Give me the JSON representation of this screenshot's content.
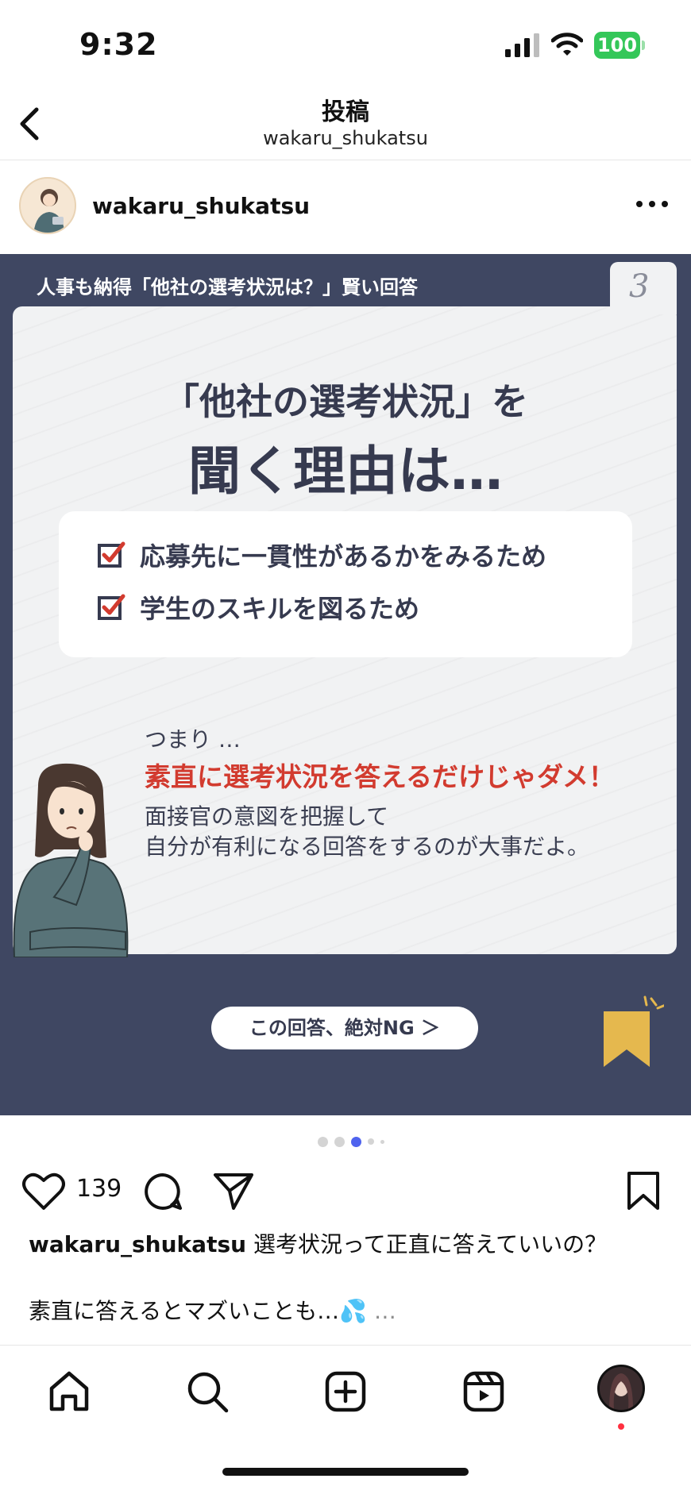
{
  "status_bar": {
    "time": "9:32",
    "battery": "100"
  },
  "header": {
    "title": "投稿",
    "subtitle": "wakaru_shukatsu"
  },
  "post": {
    "author": "wakaru_shukatsu",
    "slide": {
      "tag": "人事も納得「他社の選考状況は？」賢い回答",
      "page_number": "3",
      "headline_1": "「他社の選考状況」を",
      "headline_2": "聞く理由は…",
      "reasons": [
        "応募先に一貫性があるかをみるため",
        "学生のスキルを図るため"
      ],
      "summary_lead": "つまり …",
      "summary_emphasis": "素直に選考状況を答えるだけじゃダメ！",
      "summary_body_1": "面接官の意図を把握して",
      "summary_body_2": "自分が有利になる回答をするのが大事だよ。",
      "cta_label": "この回答、絶対NG ＞",
      "accent_red": "#d23b2f",
      "background": "#3f4762"
    },
    "carousel": {
      "total": 5,
      "active_index": 2
    },
    "likes": "139",
    "caption_user": "wakaru_shukatsu",
    "caption_text": " 選考状況って正直に答えていいの？",
    "caption_line_2": "素直に答えるとマズいことも…💦",
    "caption_more": " …"
  },
  "tab_bar": {
    "items": [
      "home-icon",
      "search-icon",
      "create-icon",
      "reels-icon",
      "profile"
    ]
  }
}
